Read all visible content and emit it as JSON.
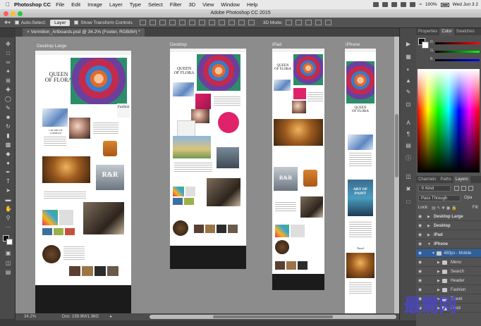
{
  "menubar": {
    "app_name": "Photoshop CC",
    "items": [
      "File",
      "Edit",
      "Image",
      "Layer",
      "Type",
      "Select",
      "Filter",
      "3D",
      "View",
      "Window",
      "Help"
    ],
    "battery": "100%",
    "clock": "Wed Jun 3 2"
  },
  "window": {
    "title": "Adobe Photoshop CC 2015"
  },
  "options": {
    "auto_select_label": "Auto-Select:",
    "auto_select_value": "Layer",
    "transform_label": "Show Transform Controls",
    "mode_label": "3D Mode:"
  },
  "document": {
    "tab_title": "Vermilion_Artboards.psd @ 34.2% (Footer, RGB/8#) *"
  },
  "artboards": {
    "desktop_large": "Desktop Large",
    "desktop": "Desktop",
    "ipad": "iPad",
    "iphone": "iPhone"
  },
  "site": {
    "headline_1": "QUEEN",
    "headline_2": "OF FLORA",
    "fashion": "Fashion",
    "rr": "R&R",
    "art_of": "ART OF",
    "paint": "PAINT",
    "beauty": "Beauty",
    "travel": "Travel",
    "colors_title": "COLORS OF",
    "colors_title_2": "COMPLEX"
  },
  "status": {
    "zoom": "34.2%",
    "doc_size": "Doc: 159.9M/1.36G"
  },
  "panels": {
    "top_tabs": [
      "Properties",
      "Color",
      "Swatches"
    ],
    "active_top_tab": "Color",
    "color_sliders": [
      "R",
      "G",
      "B"
    ],
    "bottom_tabs": [
      "Channels",
      "Paths",
      "Layers"
    ],
    "active_bottom_tab": "Layers",
    "kind_label": "Kind",
    "blend_mode": "Pass Through",
    "opacity_label": "Opa",
    "lock_label": "Lock:",
    "fill_label": "Fill",
    "layers": [
      {
        "name": "Desktop Large",
        "depth": 0,
        "type": "artboard"
      },
      {
        "name": "Desktop",
        "depth": 0,
        "type": "artboard"
      },
      {
        "name": "iPad",
        "depth": 0,
        "type": "artboard"
      },
      {
        "name": "iPhone",
        "depth": 0,
        "type": "artboard"
      },
      {
        "name": "480px - Mobile",
        "depth": 1,
        "type": "group"
      },
      {
        "name": "Menu",
        "depth": 2,
        "type": "group"
      },
      {
        "name": "Search",
        "depth": 2,
        "type": "group"
      },
      {
        "name": "Header",
        "depth": 2,
        "type": "group"
      },
      {
        "name": "Fashion",
        "depth": 2,
        "type": "group"
      },
      {
        "name": "Travel",
        "depth": 2,
        "type": "group"
      },
      {
        "name": "Food",
        "depth": 2,
        "type": "group"
      }
    ]
  },
  "watermark": "最需网",
  "colors": {
    "canvas_bg": "#8c8c8c",
    "panel_bg": "#535353",
    "selection": "#2f5f9c",
    "menu_bg": "#e9e9e9",
    "accent_pink": "#e0226a",
    "footer_dark": "#1b1b1b"
  },
  "icons": {
    "tools": [
      "move-icon",
      "marquee-icon",
      "lasso-icon",
      "quick-select-icon",
      "crop-icon",
      "eyedropper-icon",
      "healing-icon",
      "brush-icon",
      "stamp-icon",
      "history-brush-icon",
      "eraser-icon",
      "gradient-icon",
      "blur-icon",
      "dodge-icon",
      "pen-icon",
      "type-icon",
      "path-select-icon",
      "shape-icon",
      "hand-icon",
      "zoom-icon"
    ]
  }
}
